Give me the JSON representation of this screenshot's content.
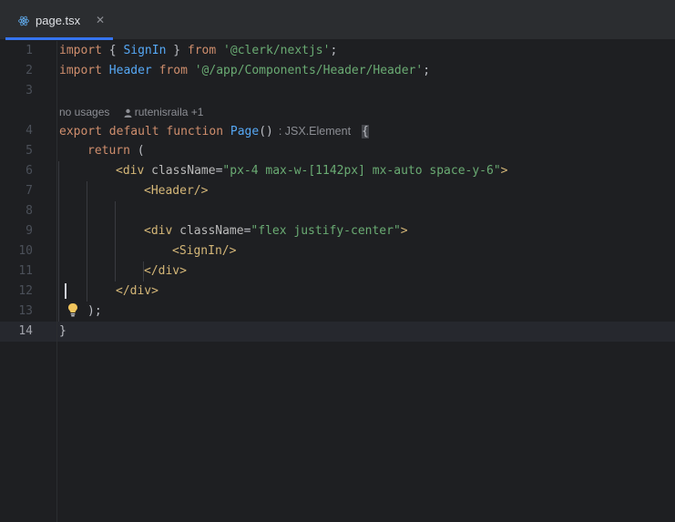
{
  "tab": {
    "filename": "page.tsx",
    "icon": "react-icon",
    "close_icon": "close-icon"
  },
  "hint": {
    "usages": "no usages",
    "author": "rutenisraila +1"
  },
  "type_hint": ": JSX.Element",
  "active_line": 14,
  "lines": [
    {
      "num": "1",
      "t1": "import",
      "t2": " { ",
      "t3": "SignIn",
      "t4": " } ",
      "t5": "from",
      "t6": " ",
      "t7": "'@clerk/nextjs'",
      "t8": ";"
    },
    {
      "num": "2",
      "t1": "import",
      "t2": " ",
      "t3": "Header",
      "t4": " ",
      "t5": "from",
      "t6": " ",
      "t7": "'@/app/Components/Header/Header'",
      "t8": ";"
    },
    {
      "num": "3"
    },
    {
      "num": "4",
      "t1": "export",
      "t2": " ",
      "t3": "default",
      "t4": " ",
      "t5": "function",
      "t6": " ",
      "t7": "Page",
      "t8": "()",
      "t9": "{"
    },
    {
      "num": "5",
      "t1": "return",
      "t2": " ("
    },
    {
      "num": "6",
      "t1": "<div",
      "t2": " className",
      "t3": "=",
      "t4": "\"px-4 max-w-[1142px] mx-auto space-y-6\"",
      "t5": ">"
    },
    {
      "num": "7",
      "t1": "<Header",
      "t2": "/>"
    },
    {
      "num": "8"
    },
    {
      "num": "9",
      "t1": "<div",
      "t2": " className",
      "t3": "=",
      "t4": "\"flex justify-center\"",
      "t5": ">"
    },
    {
      "num": "10",
      "t1": "<SignIn",
      "t2": "/>"
    },
    {
      "num": "11",
      "t1": "</div",
      "t2": ">"
    },
    {
      "num": "12",
      "t1": "</div",
      "t2": ">"
    },
    {
      "num": "13",
      "t1": ");"
    },
    {
      "num": "14",
      "t1": "}"
    }
  ]
}
